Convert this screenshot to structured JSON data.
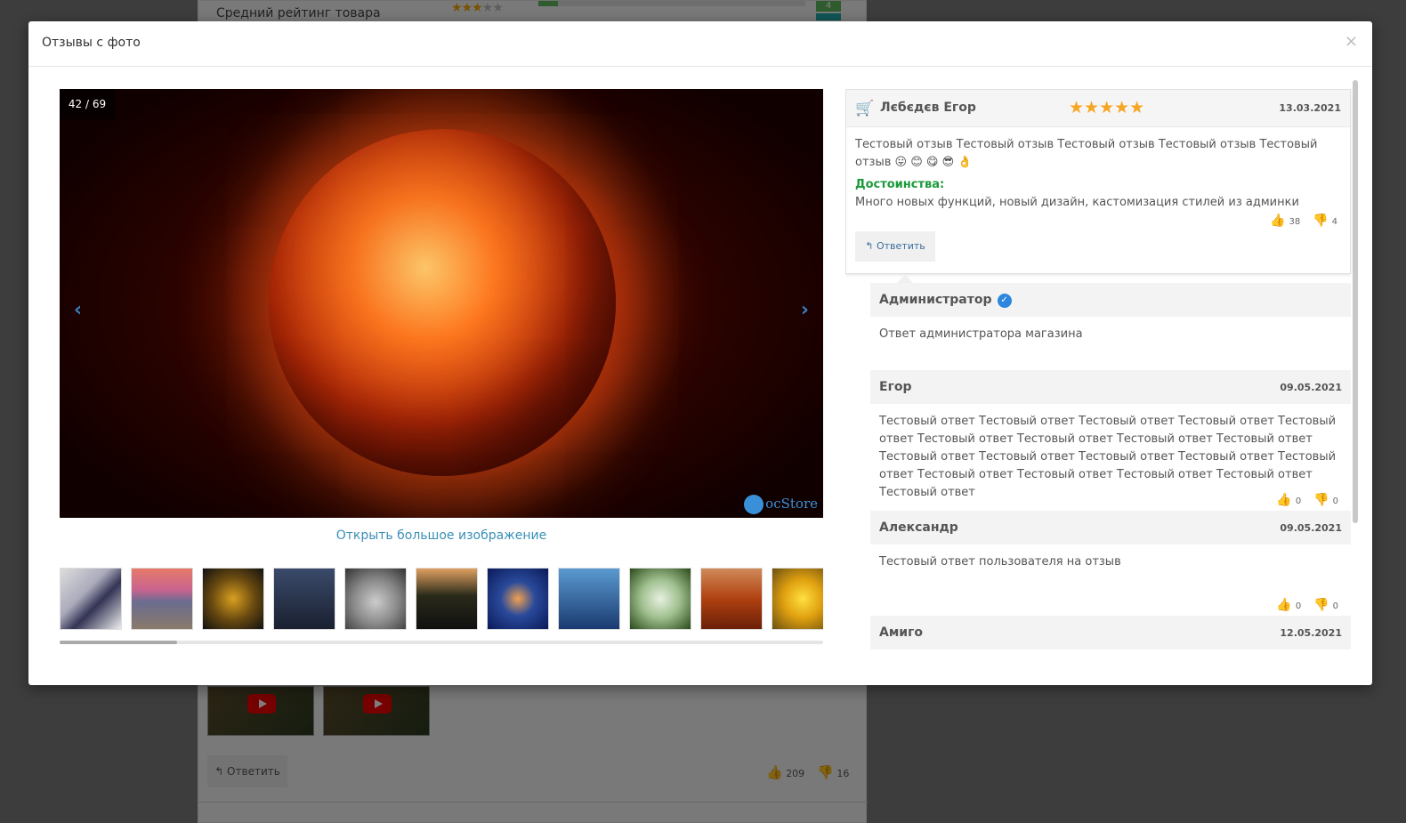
{
  "background": {
    "rating_label": "Средний рейтинг товара",
    "rating_count": "4",
    "reply_label": "↰ Ответить",
    "likes": "209",
    "dislikes": "16"
  },
  "modal": {
    "title": "Отзывы с фото",
    "close": "×"
  },
  "gallery": {
    "counter": "42 / 69",
    "prev": "‹",
    "next": "›",
    "watermark": "ocStore",
    "open_large": "Открыть большое изображение",
    "thumbnail_count": 11
  },
  "review": {
    "author": "Лєбєдєв Егор",
    "stars": "★★★★★",
    "rating": 5,
    "date": "13.03.2021",
    "text": "Тестовый отзыв Тестовый отзыв Тестовый отзыв Тестовый отзыв Тестовый отзыв",
    "emojis": "😛 😊 😋 😎 👌",
    "pros_label": "Достоинства:",
    "pros_text": "Много новых функций, новый дизайн, кастомизация стилей из админки",
    "likes": "38",
    "dislikes": "4",
    "reply_label": "↰ Ответить"
  },
  "replies": [
    {
      "author": "Администратор",
      "verified": true,
      "date": "",
      "text": "Ответ администратора магазина"
    },
    {
      "author": "Егор",
      "date": "09.05.2021",
      "text": "Тестовый ответ Тестовый ответ Тестовый ответ Тестовый ответ Тестовый ответ Тестовый ответ Тестовый ответ Тестовый ответ Тестовый ответ Тестовый ответ Тестовый ответ Тестовый ответ Тестовый ответ Тестовый ответ Тестовый ответ Тестовый ответ Тестовый ответ Тестовый ответ Тестовый ответ",
      "likes": "0",
      "dislikes": "0"
    },
    {
      "author": "Александр",
      "date": "09.05.2021",
      "text": "Тестовый ответ пользователя на отзыв",
      "likes": "0",
      "dislikes": "0"
    },
    {
      "author": "Амиго",
      "date": "12.05.2021",
      "text": ""
    }
  ],
  "colors": {
    "accent_blue": "#3a8fb7",
    "green": "#1a9a3a",
    "star": "#f5a623",
    "dislike_red": "#e05050"
  }
}
